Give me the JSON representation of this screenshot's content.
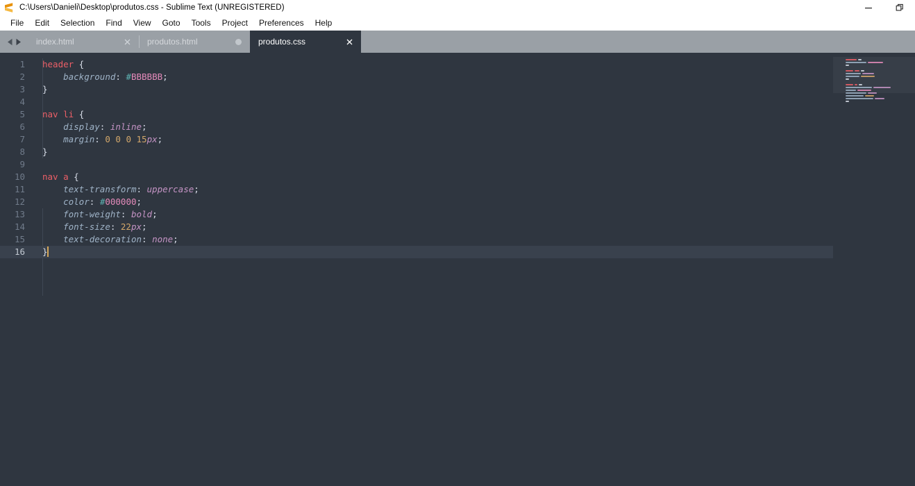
{
  "window": {
    "title": "C:\\Users\\Danieli\\Desktop\\produtos.css - Sublime Text (UNREGISTERED)",
    "app_icon": "sublime-text-logo",
    "controls": [
      {
        "name": "minimize-button",
        "glyph": "minimize-icon"
      },
      {
        "name": "restore-button",
        "glyph": "restore-icon"
      }
    ]
  },
  "menubar": {
    "items": [
      {
        "label": "File"
      },
      {
        "label": "Edit"
      },
      {
        "label": "Selection"
      },
      {
        "label": "Find"
      },
      {
        "label": "View"
      },
      {
        "label": "Goto"
      },
      {
        "label": "Tools"
      },
      {
        "label": "Project"
      },
      {
        "label": "Preferences"
      },
      {
        "label": "Help"
      }
    ]
  },
  "tabbar": {
    "nav_prev": "chevron-left-icon",
    "nav_next": "chevron-right-icon",
    "tabs": [
      {
        "label": "index.html",
        "active": false,
        "dirty": false
      },
      {
        "label": "produtos.html",
        "active": false,
        "dirty": true
      },
      {
        "label": "produtos.css",
        "active": true,
        "dirty": false
      }
    ]
  },
  "editor": {
    "language": "CSS",
    "cursor_line": 16,
    "line_numbers": [
      "1",
      "2",
      "3",
      "4",
      "5",
      "6",
      "7",
      "8",
      "9",
      "10",
      "11",
      "12",
      "13",
      "14",
      "15",
      "16"
    ],
    "lines": [
      {
        "n": 1,
        "text": "header {"
      },
      {
        "n": 2,
        "text": "    background: #BBBBBB;"
      },
      {
        "n": 3,
        "text": "}"
      },
      {
        "n": 4,
        "text": ""
      },
      {
        "n": 5,
        "text": "nav li {"
      },
      {
        "n": 6,
        "text": "    display: inline;"
      },
      {
        "n": 7,
        "text": "    margin: 0 0 0 15px;"
      },
      {
        "n": 8,
        "text": "}"
      },
      {
        "n": 9,
        "text": ""
      },
      {
        "n": 10,
        "text": "nav a {"
      },
      {
        "n": 11,
        "text": "    text-transform: uppercase;"
      },
      {
        "n": 12,
        "text": "    color: #000000;"
      },
      {
        "n": 13,
        "text": "    font-weight: bold;"
      },
      {
        "n": 14,
        "text": "    font-size: 22px;"
      },
      {
        "n": 15,
        "text": "    text-decoration: none;"
      },
      {
        "n": 16,
        "text": "}"
      }
    ],
    "tokens": [
      [
        {
          "t": "header",
          "c": "t-sel"
        },
        {
          "t": " {",
          "c": "t-punct"
        }
      ],
      [
        {
          "t": "    ",
          "c": "t-punct"
        },
        {
          "t": "background",
          "c": "t-prop"
        },
        {
          "t": ": ",
          "c": "t-punct"
        },
        {
          "t": "#",
          "c": "t-hash"
        },
        {
          "t": "BBBBBB",
          "c": "t-hex"
        },
        {
          "t": ";",
          "c": "t-punct"
        }
      ],
      [
        {
          "t": "}",
          "c": "t-punct"
        }
      ],
      [
        {
          "t": "",
          "c": "t-punct"
        }
      ],
      [
        {
          "t": "nav",
          "c": "t-sel"
        },
        {
          "t": " ",
          "c": "t-punct"
        },
        {
          "t": "li",
          "c": "t-sel"
        },
        {
          "t": " {",
          "c": "t-punct"
        }
      ],
      [
        {
          "t": "    ",
          "c": "t-punct"
        },
        {
          "t": "display",
          "c": "t-prop"
        },
        {
          "t": ": ",
          "c": "t-punct"
        },
        {
          "t": "inline",
          "c": "t-kw"
        },
        {
          "t": ";",
          "c": "t-punct"
        }
      ],
      [
        {
          "t": "    ",
          "c": "t-punct"
        },
        {
          "t": "margin",
          "c": "t-prop"
        },
        {
          "t": ": ",
          "c": "t-punct"
        },
        {
          "t": "0",
          "c": "t-num"
        },
        {
          "t": " ",
          "c": "t-punct"
        },
        {
          "t": "0",
          "c": "t-num"
        },
        {
          "t": " ",
          "c": "t-punct"
        },
        {
          "t": "0",
          "c": "t-num"
        },
        {
          "t": " ",
          "c": "t-punct"
        },
        {
          "t": "15",
          "c": "t-num"
        },
        {
          "t": "px",
          "c": "t-kw"
        },
        {
          "t": ";",
          "c": "t-punct"
        }
      ],
      [
        {
          "t": "}",
          "c": "t-punct"
        }
      ],
      [
        {
          "t": "",
          "c": "t-punct"
        }
      ],
      [
        {
          "t": "nav",
          "c": "t-sel"
        },
        {
          "t": " ",
          "c": "t-punct"
        },
        {
          "t": "a",
          "c": "t-sel"
        },
        {
          "t": " {",
          "c": "t-punct"
        }
      ],
      [
        {
          "t": "    ",
          "c": "t-punct"
        },
        {
          "t": "text-transform",
          "c": "t-prop"
        },
        {
          "t": ": ",
          "c": "t-punct"
        },
        {
          "t": "uppercase",
          "c": "t-kw"
        },
        {
          "t": ";",
          "c": "t-punct"
        }
      ],
      [
        {
          "t": "    ",
          "c": "t-punct"
        },
        {
          "t": "color",
          "c": "t-prop"
        },
        {
          "t": ": ",
          "c": "t-punct"
        },
        {
          "t": "#",
          "c": "t-hash"
        },
        {
          "t": "000000",
          "c": "t-hex"
        },
        {
          "t": ";",
          "c": "t-punct"
        }
      ],
      [
        {
          "t": "    ",
          "c": "t-punct"
        },
        {
          "t": "font-weight",
          "c": "t-prop"
        },
        {
          "t": ": ",
          "c": "t-punct"
        },
        {
          "t": "bold",
          "c": "t-kw"
        },
        {
          "t": ";",
          "c": "t-punct"
        }
      ],
      [
        {
          "t": "    ",
          "c": "t-punct"
        },
        {
          "t": "font-size",
          "c": "t-prop"
        },
        {
          "t": ": ",
          "c": "t-punct"
        },
        {
          "t": "22",
          "c": "t-num"
        },
        {
          "t": "px",
          "c": "t-kw"
        },
        {
          "t": ";",
          "c": "t-punct"
        }
      ],
      [
        {
          "t": "    ",
          "c": "t-punct"
        },
        {
          "t": "text-decoration",
          "c": "t-prop"
        },
        {
          "t": ": ",
          "c": "t-punct"
        },
        {
          "t": "none",
          "c": "t-kw"
        },
        {
          "t": ";",
          "c": "t-punct"
        }
      ],
      [
        {
          "t": "}",
          "c": "t-punct"
        }
      ]
    ]
  },
  "minimap": {
    "name": "code-minimap",
    "rows": [
      [
        {
          "w": 16,
          "c": "#ec5f67"
        },
        {
          "w": 5,
          "c": "#d8dee9"
        }
      ],
      [
        {
          "w": 30,
          "c": "#9fb3c7"
        },
        {
          "w": 22,
          "c": "#e58bbb"
        }
      ],
      [
        {
          "w": 5,
          "c": "#d8dee9"
        }
      ],
      [],
      [
        {
          "w": 11,
          "c": "#ec5f67"
        },
        {
          "w": 7,
          "c": "#ec5f67"
        },
        {
          "w": 5,
          "c": "#d8dee9"
        }
      ],
      [
        {
          "w": 22,
          "c": "#9fb3c7"
        },
        {
          "w": 17,
          "c": "#c594c5"
        }
      ],
      [
        {
          "w": 20,
          "c": "#9fb3c7"
        },
        {
          "w": 20,
          "c": "#d3a76a"
        }
      ],
      [
        {
          "w": 5,
          "c": "#d8dee9"
        }
      ],
      [],
      [
        {
          "w": 11,
          "c": "#ec5f67"
        },
        {
          "w": 4,
          "c": "#ec5f67"
        },
        {
          "w": 5,
          "c": "#d8dee9"
        }
      ],
      [
        {
          "w": 38,
          "c": "#9fb3c7"
        },
        {
          "w": 25,
          "c": "#c594c5"
        }
      ],
      [
        {
          "w": 15,
          "c": "#9fb3c7"
        },
        {
          "w": 20,
          "c": "#e58bbb"
        }
      ],
      [
        {
          "w": 30,
          "c": "#9fb3c7"
        },
        {
          "w": 13,
          "c": "#c594c5"
        }
      ],
      [
        {
          "w": 26,
          "c": "#9fb3c7"
        },
        {
          "w": 13,
          "c": "#d3a76a"
        }
      ],
      [
        {
          "w": 40,
          "c": "#9fb3c7"
        },
        {
          "w": 14,
          "c": "#c594c5"
        }
      ],
      [
        {
          "w": 5,
          "c": "#d8dee9"
        }
      ]
    ]
  },
  "colors": {
    "editor_bg": "#2f3640",
    "current_line_bg": "#39414d",
    "tabbar_bg": "#9aa0a6",
    "selector": "#ec5f67",
    "property": "#9fb3c7",
    "keyword": "#c594c5",
    "number": "#d3a76a",
    "hex_digits": "#e58bbb",
    "hash": "#5fb3b3",
    "caret": "#d6a758"
  }
}
